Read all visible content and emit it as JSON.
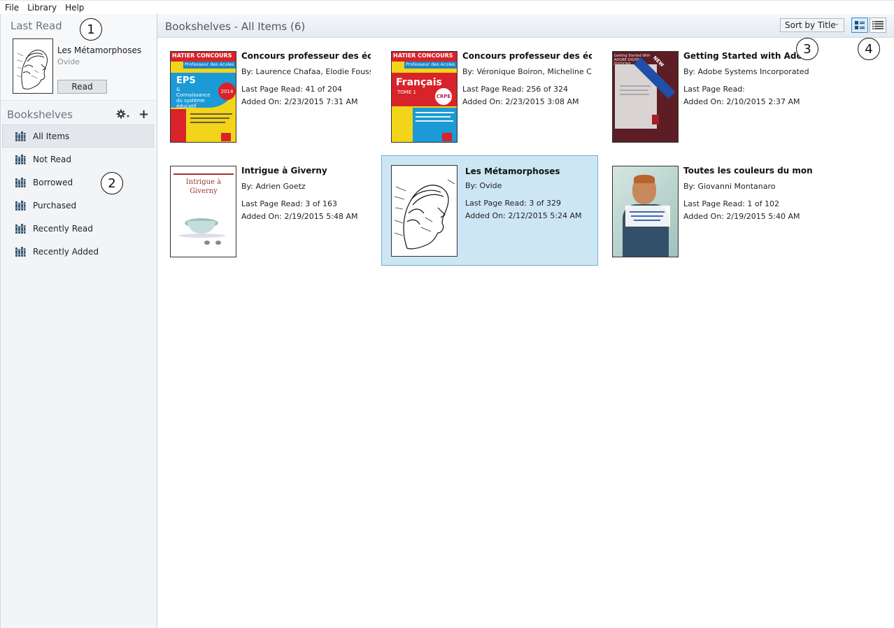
{
  "menu": [
    "File",
    "Library",
    "Help"
  ],
  "last_read": {
    "heading": "Last Read",
    "title": "Les Métamorphoses",
    "author": "Ovide",
    "read_button": "Read"
  },
  "bookshelves": {
    "heading": "Bookshelves",
    "items": [
      {
        "label": "All Items"
      },
      {
        "label": "Not Read"
      },
      {
        "label": "Borrowed"
      },
      {
        "label": "Purchased"
      },
      {
        "label": "Recently Read"
      },
      {
        "label": "Recently Added"
      }
    ]
  },
  "toolbar": {
    "title": "Bookshelves - All Items (6)",
    "sort_label": "Sort by Title"
  },
  "books": [
    {
      "title": "Concours professeur des écol...",
      "author": "By:  Laurence Chafaa, Elodie Foussar...",
      "last_page": "Last Page Read:  41 of 204",
      "added": "Added On:  2/23/2015 7:31 AM",
      "cover": {
        "brand": "HATIER CONCOURS",
        "subtitle": "Professeur des écoles",
        "big": "EPS",
        "small": "& Connaissance du système éducatif",
        "badge": "2014"
      }
    },
    {
      "title": "Concours professeur des écol...",
      "author": "By:  Véronique Boiron, Micheline Cel...",
      "last_page": "Last Page Read:  256 of 324",
      "added": "Added On:  2/23/2015 3:08 AM",
      "cover": {
        "brand": "HATIER CONCOURS",
        "subtitle": "Professeur des écoles",
        "big": "Français",
        "small": "TOME 1",
        "badge": "CRPE"
      }
    },
    {
      "title": "Getting Started with Adobe D...",
      "author": "By:  Adobe Systems Incorporated",
      "last_page": "Last Page Read:",
      "added": "Added On:  2/10/2015 2:37 AM",
      "cover": {
        "top": "Getting Started With ADOBE DIGITAL EDITIONS",
        "ribbon": "NEW"
      }
    },
    {
      "title": "Intrigue à Giverny",
      "author": "By:  Adrien Goetz",
      "last_page": "Last Page Read:  3 of 163",
      "added": "Added On:  2/19/2015 5:48 AM",
      "cover": {
        "top": "Intrigue à Giverny"
      }
    },
    {
      "title": "Les Métamorphoses",
      "author": "By:  Ovide",
      "last_page": "Last Page Read:  3 of 329",
      "added": "Added On:  2/12/2015 5:24 AM"
    },
    {
      "title": "Toutes les couleurs du monde",
      "author": "By:  Giovanni Montanaro",
      "last_page": "Last Page Read:  1 of 102",
      "added": "Added On:  2/19/2015 5:40 AM"
    }
  ],
  "callouts": [
    "1",
    "2",
    "3",
    "4"
  ],
  "colors": {
    "accent": "#3c8fc9",
    "selected_bg": "#cce6f4",
    "sidebar_bg": "#f2f4f7"
  }
}
